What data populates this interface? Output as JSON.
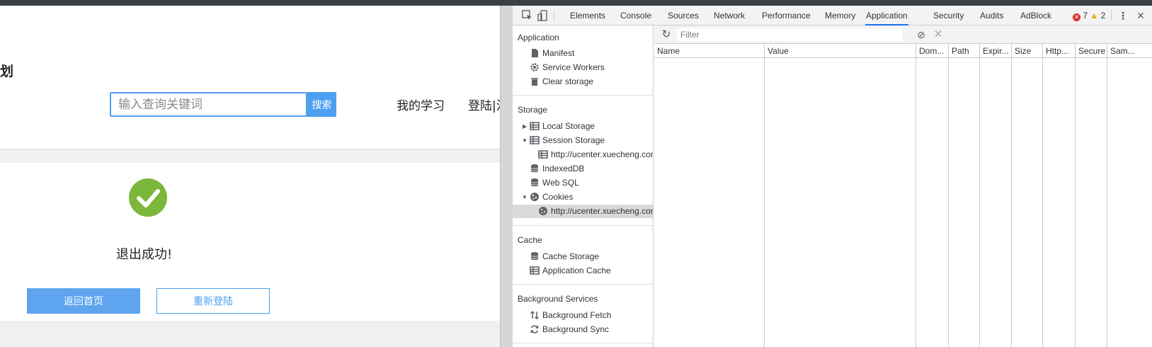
{
  "page": {
    "brand_fragment": "划",
    "search": {
      "placeholder": "输入查询关键词",
      "button": "搜索"
    },
    "nav": [
      "我的学习",
      "登陆|注"
    ],
    "result": {
      "message": "退出成功!"
    },
    "buttons": {
      "home": "返回首页",
      "relogin": "重新登陆"
    },
    "colors": {
      "accent": "#4d9ff0",
      "success": "#7cb63a"
    }
  },
  "devtools": {
    "toolbar_icons": [
      "inspect-icon",
      "device-toggle-icon",
      "kebab-menu-icon",
      "close-icon"
    ],
    "tabs": [
      "Elements",
      "Console",
      "Sources",
      "Network",
      "Performance",
      "Memory",
      "Application",
      "Security",
      "Audits",
      "AdBlock"
    ],
    "active_tab": "Application",
    "errors": "7",
    "warnings": "2",
    "sidebar": {
      "application": {
        "title": "Application",
        "items": [
          "Manifest",
          "Service Workers",
          "Clear storage"
        ]
      },
      "storage": {
        "title": "Storage",
        "local_storage": "Local Storage",
        "session_storage": "Session Storage",
        "session_origin": "http://ucenter.xuecheng.com",
        "indexeddb": "IndexedDB",
        "websql": "Web SQL",
        "cookies": "Cookies",
        "cookie_origin": "http://ucenter.xuecheng.com"
      },
      "cache": {
        "title": "Cache",
        "items": [
          "Cache Storage",
          "Application Cache"
        ]
      },
      "background": {
        "title": "Background Services",
        "items": [
          "Background Fetch",
          "Background Sync"
        ]
      }
    },
    "filter": {
      "placeholder": "Filter"
    },
    "table": {
      "columns": [
        "Name",
        "Value",
        "Dom...",
        "Path",
        "Expir...",
        "Size",
        "Http...",
        "Secure",
        "Sam..."
      ],
      "rows": []
    }
  }
}
